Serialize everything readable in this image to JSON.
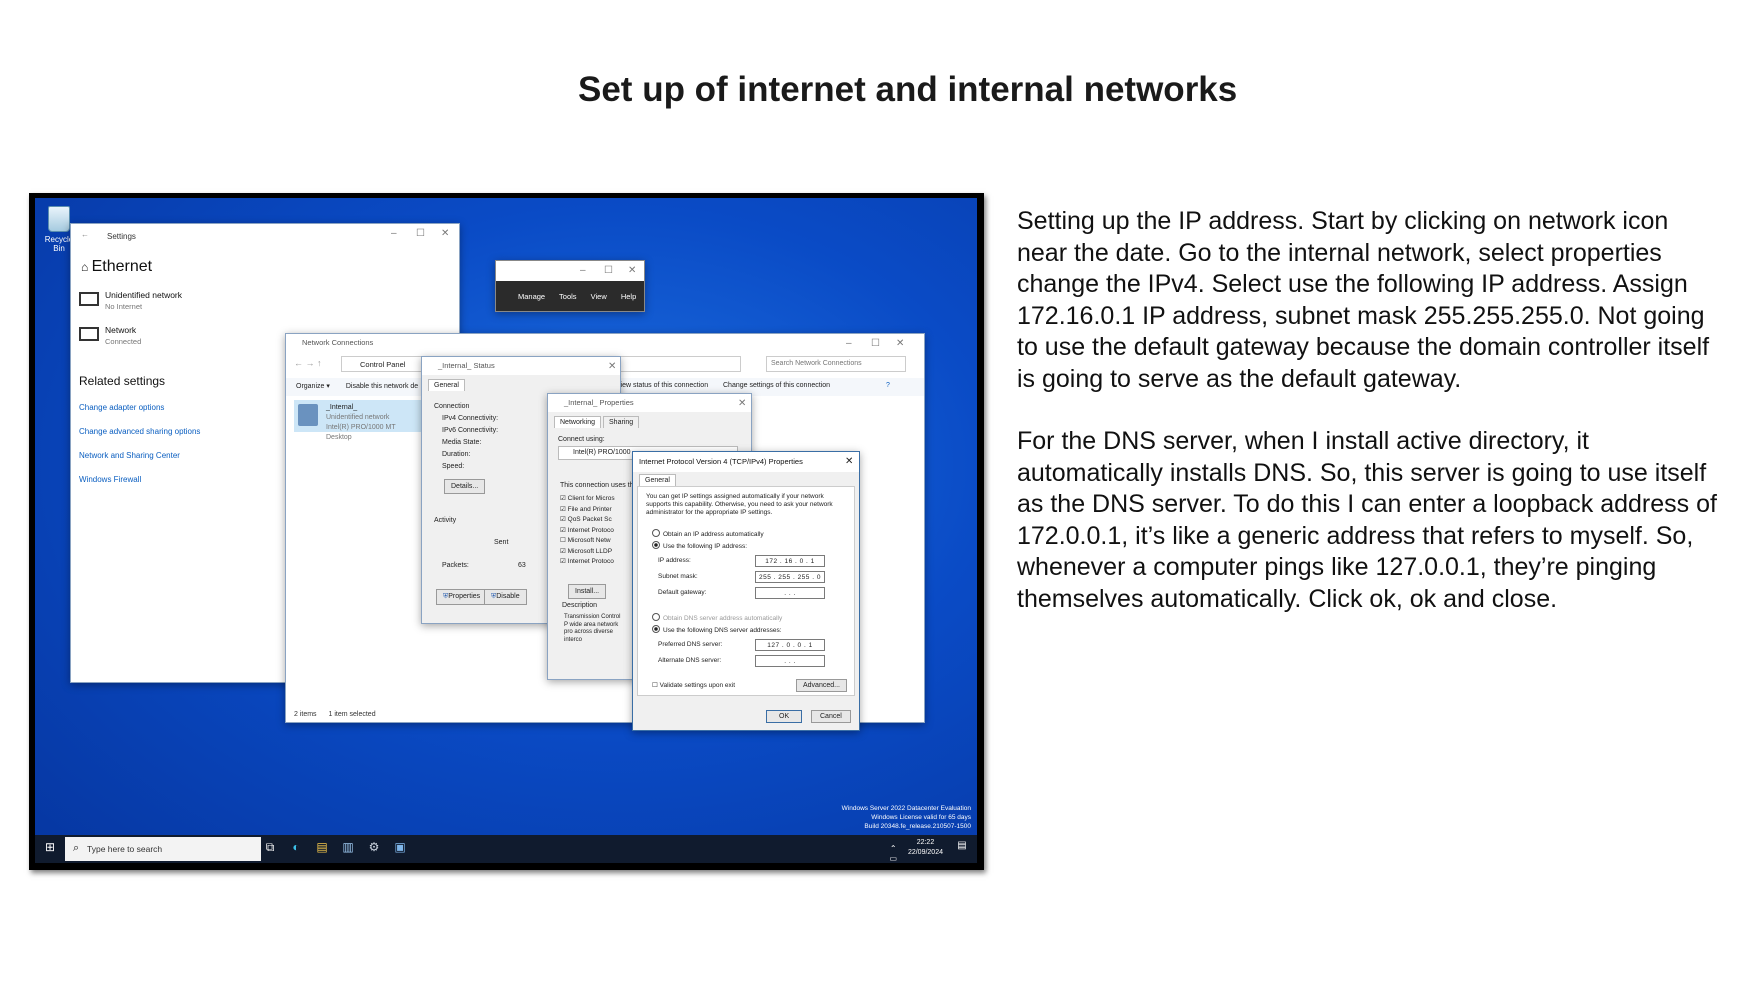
{
  "slide": {
    "title": "Set up of internet and internal networks",
    "paragraph1": "Setting up the IP address. Start by clicking on network icon near the date. Go to the internal network, select properties change the IPv4. Select use the following IP address. Assign 172.16.0.1 IP address, subnet mask 255.255.255.0. Not going to use the default gateway because the domain controller itself is going to serve as the default gateway.",
    "paragraph2": "For the DNS server, when I install active directory, it automatically installs DNS. So, this server is going to use itself as the DNS server. To do this I can enter a loopback address of 172.0.0.1, it’s like a generic address that refers to myself. So, whenever a computer pings like 127.0.0.1, they’re pinging themselves automatically. Click ok, ok and close."
  },
  "desktop": {
    "recycle_label": "Recycle Bin",
    "watermark": [
      "Windows Server 2022 Datacenter Evaluation",
      "Windows License valid for 65 days",
      "Build 20348.fe_release.210507-1500"
    ]
  },
  "settings": {
    "window_title": "Settings",
    "page_title": "Ethernet",
    "net1_name": "Unidentified network",
    "net1_status": "No Internet",
    "net2_name": "Network",
    "net2_status": "Connected",
    "related_heading": "Related settings",
    "links": [
      "Change adapter options",
      "Change advanced sharing options",
      "Network and Sharing Center",
      "Windows Firewall"
    ]
  },
  "server_manager": {
    "menu": "Manage Tools View Help"
  },
  "network_connections": {
    "title": "Network Connections",
    "address": "Control Panel",
    "search_placeholder": "Search Network Connections",
    "organize": "Organize ▾",
    "disable": "Disable this network de",
    "view_status": "View status of this connection",
    "change_settings": "Change settings of this connection",
    "item_name": "_Internal_",
    "item_status": "Unidentified network",
    "item_adapter": "Intel(R) PRO/1000 MT Desktop",
    "status_count": "2 items",
    "status_selected": "1 item selected"
  },
  "internal_status": {
    "title": "_Internal_ Status",
    "tab": "General",
    "connection": "Connection",
    "ipv4": "IPv4 Connectivity:",
    "ipv6": "IPv6 Connectivity:",
    "media": "Media State:",
    "duration": "Duration:",
    "speed": "Speed:",
    "details": "Details...",
    "activity": "Activity",
    "sent": "Sent",
    "packets": "Packets:",
    "packets_value": "63",
    "properties": "Properties",
    "disable": "Disable"
  },
  "internal_properties": {
    "title": "_Internal_ Properties",
    "tab_networking": "Networking",
    "tab_sharing": "Sharing",
    "connect_using": "Connect using:",
    "adapter": "Intel(R) PRO/1000",
    "uses": "This connection uses the",
    "items": [
      "Client for Micros",
      "File and Printer",
      "QoS Packet Sc",
      "Internet Protoco",
      "Microsoft Netw",
      "Microsoft LLDP",
      "Internet Protoco"
    ],
    "install": "Install...",
    "description": "Description",
    "desc_text": "Transmission Control P wide area network pro across diverse interco"
  },
  "ipv4": {
    "title": "Internet Protocol Version 4 (TCP/IPv4) Properties",
    "tab": "General",
    "intro": "You can get IP settings assigned automatically if your network supports this capability. Otherwise, you need to ask your network administrator for the appropriate IP settings.",
    "obtain_ip": "Obtain an IP address automatically",
    "use_ip": "Use the following IP address:",
    "ip_label": "IP address:",
    "ip_value": "172 . 16 . 0 . 1",
    "mask_label": "Subnet mask:",
    "mask_value": "255 . 255 . 255 . 0",
    "gw_label": "Default gateway:",
    "gw_value": ".   .   .",
    "obtain_dns": "Obtain DNS server address automatically",
    "use_dns": "Use the following DNS server addresses:",
    "pref_label": "Preferred DNS server:",
    "pref_value": "127 . 0 . 0 . 1",
    "alt_label": "Alternate DNS server:",
    "alt_value": ".   .   .",
    "validate": "Validate settings upon exit",
    "advanced": "Advanced...",
    "ok": "OK",
    "cancel": "Cancel"
  },
  "taskbar": {
    "search_placeholder": "Type here to search",
    "time": "22:22",
    "date": "22/09/2024"
  }
}
